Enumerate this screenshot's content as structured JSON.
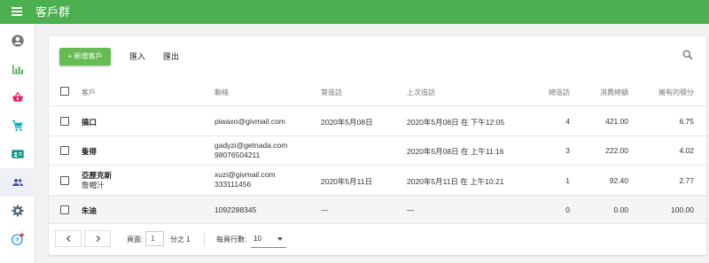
{
  "app": {
    "title": "客戶群"
  },
  "sidebar": {
    "items": [
      {
        "icon": "account-circle-icon",
        "name": "nav-account",
        "color": "#757575"
      },
      {
        "icon": "bar-chart-icon",
        "name": "nav-reports",
        "color": "#4caf50"
      },
      {
        "icon": "basket-icon",
        "name": "nav-sales",
        "color": "#e91e63"
      },
      {
        "icon": "cart-icon",
        "name": "nav-cart",
        "color": "#00acc1"
      },
      {
        "icon": "contact-card-icon",
        "name": "nav-contacts",
        "color": "#009688"
      },
      {
        "icon": "people-icon",
        "name": "nav-customers",
        "color": "#3f51b5",
        "active": true
      },
      {
        "icon": "gear-icon",
        "name": "nav-settings",
        "color": "#546e7a"
      },
      {
        "icon": "help-icon",
        "name": "nav-help",
        "color": "#2196f3"
      }
    ]
  },
  "toolbar": {
    "new_label": "+ 新增客戶",
    "import_label": "匯入",
    "export_label": "匯出"
  },
  "table": {
    "headers": {
      "customer": "客戶",
      "contact": "聯絡",
      "first_visit": "第造訪",
      "last_visit": "上次造訪",
      "visits": "總造訪",
      "spent": "消費總額",
      "points": "擁有的積分"
    },
    "rows": [
      {
        "name": "搞口",
        "name2": "",
        "contact1": "piwaxo@givmail.com",
        "contact2": "",
        "first_visit": "2020年5月08日",
        "last_visit": "2020年5月08日 在 下午12:05",
        "visits": "4",
        "spent": "421.00",
        "points": "6.75"
      },
      {
        "name": "隻得",
        "name2": "",
        "contact1": "gadyzi@getnada.com",
        "contact2": "98076504211",
        "first_visit": "",
        "last_visit": "2020年5月08日 在 上午11:16",
        "visits": "3",
        "spent": "222.00",
        "points": "4.02"
      },
      {
        "name": "亞歷克斯",
        "name2": "詹帽汁",
        "contact1": "xuzi@givmail.com",
        "contact2": "333111456",
        "first_visit": "2020年5月11日",
        "last_visit": "2020年5月11日 在 上午10:21",
        "visits": "1",
        "spent": "92.40",
        "points": "2.77"
      },
      {
        "name": "朱迪",
        "name2": "",
        "contact1": "1092288345",
        "contact2": "",
        "first_visit": "—",
        "last_visit": "—",
        "visits": "0",
        "spent": "0.00",
        "points": "100.00"
      }
    ]
  },
  "pagination": {
    "page_label": "頁面:",
    "page_value": "1",
    "page_total": "分之 1",
    "rows_label": "每頁行數:",
    "rows_value": "10"
  },
  "colors": {
    "appbar": "#4caf50",
    "new_button": "#66bb52"
  }
}
